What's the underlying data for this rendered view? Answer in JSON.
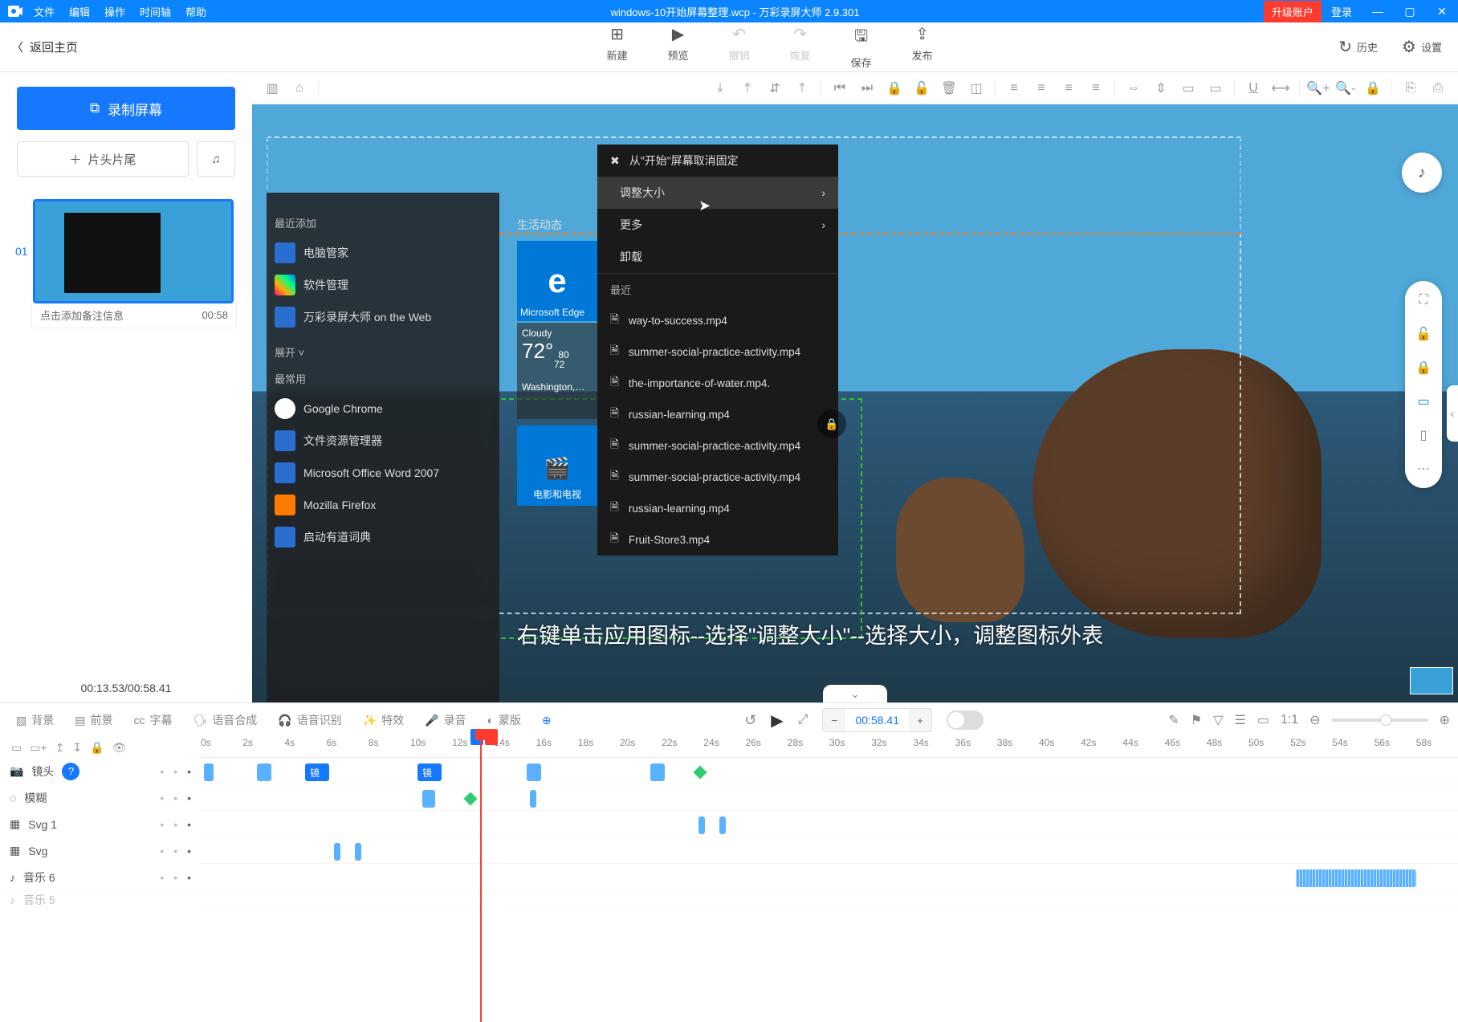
{
  "titleBar": {
    "menus": [
      "文件",
      "编辑",
      "操作",
      "时间轴",
      "帮助"
    ],
    "title": "windows-10开始屏幕整理.wcp - 万彩录屏大师 2.9.301",
    "upgrade": "升级账户",
    "login": "登录"
  },
  "backHome": "返回主页",
  "topTools": {
    "new": "新建",
    "preview": "预览",
    "undo": "撤销",
    "redo": "恢复",
    "save": "保存",
    "publish": "发布",
    "history": "历史",
    "settings": "设置"
  },
  "leftPanel": {
    "record": "录制屏幕",
    "intro": "片头片尾",
    "index": "01",
    "caption": "点击添加备注信息",
    "duration": "00:58",
    "timecodes": "00:13.53/00:58.41"
  },
  "startMenu": {
    "recentAdded": "最近添加",
    "items1": [
      "电脑管家",
      "软件管理",
      "万彩录屏大师 on the Web"
    ],
    "expand": "展开 ˅",
    "mostUsed": "最常用",
    "items2": [
      "Google Chrome",
      "文件资源管理器",
      "Microsoft Office Word 2007",
      "Mozilla Firefox",
      "启动有道词典"
    ],
    "liveHeader": "生活动态",
    "edge": "Microsoft Edge",
    "weatherLabel": "Cloudy",
    "weatherTemp": "72°",
    "weatherHi": "80",
    "weatherLo": "72",
    "weatherCity": "Washington,…",
    "videoTile": "电影和电视"
  },
  "contextMenu": {
    "item1": "从\"开始\"屏幕取消固定",
    "item2": "调整大小",
    "item3": "更多",
    "item4": "卸载",
    "recent": "最近",
    "files": [
      "way-to-success.mp4",
      "summer-social-practice-activity.mp4",
      "the-importance-of-water.mp4.",
      "russian-learning.mp4",
      "summer-social-practice-activity.mp4",
      "summer-social-practice-activity.mp4",
      "russian-learning.mp4",
      "Fruit-Store3.mp4"
    ]
  },
  "subtitle": "右键单击应用图标--选择\"调整大小\"--选择大小，调整图标外表",
  "timelineTop": {
    "tabs": [
      "背景",
      "前景",
      "字幕",
      "语音合成",
      "语音识别",
      "特效",
      "录音",
      "蒙版"
    ],
    "time": "00:58.41"
  },
  "ruler": [
    "0s",
    "2s",
    "4s",
    "6s",
    "8s",
    "10s",
    "12s",
    "14s",
    "16s",
    "18s",
    "20s",
    "22s",
    "24s",
    "26s",
    "28s",
    "30s",
    "32s",
    "34s",
    "36s",
    "38s",
    "40s",
    "42s",
    "44s",
    "46s",
    "48s",
    "50s",
    "52s",
    "54s",
    "56s",
    "58s"
  ],
  "tracks": {
    "lens": "镜头",
    "lensClip": "镜",
    "blur": "模糊",
    "svg1": "Svg 1",
    "svg": "Svg",
    "music": "音乐 6",
    "music2": "音乐 5"
  }
}
